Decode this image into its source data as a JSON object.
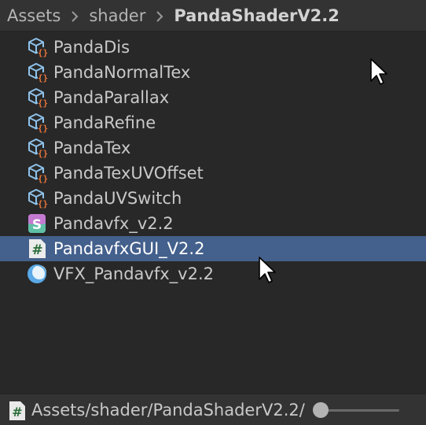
{
  "breadcrumb": {
    "items": [
      "Assets",
      "shader",
      "PandaShaderV2.2"
    ]
  },
  "files": [
    {
      "name": "PandaDis",
      "icon": "shader-cube-icon"
    },
    {
      "name": "PandaNormalTex",
      "icon": "shader-cube-icon"
    },
    {
      "name": "PandaParallax",
      "icon": "shader-cube-icon"
    },
    {
      "name": "PandaRefine",
      "icon": "shader-cube-icon"
    },
    {
      "name": "PandaTex",
      "icon": "shader-cube-icon"
    },
    {
      "name": "PandaTexUVOffset",
      "icon": "shader-cube-icon"
    },
    {
      "name": "PandaUVSwitch",
      "icon": "shader-cube-icon"
    },
    {
      "name": "Pandavfx_v2.2",
      "icon": "shader-graph-icon"
    },
    {
      "name": "PandavfxGUI_V2.2",
      "icon": "csharp-script-icon",
      "selected": true
    },
    {
      "name": "VFX_Pandavfx_v2.2",
      "icon": "material-sphere-icon"
    }
  ],
  "status": {
    "path": "Assets/shader/PandaShaderV2.2/",
    "icon": "csharp-script-icon",
    "zoom": 0
  },
  "colors": {
    "background": "#282828",
    "selected": "#44608c",
    "shader_brace": "#e8743a",
    "shader_cube": "#8fc2ea"
  }
}
